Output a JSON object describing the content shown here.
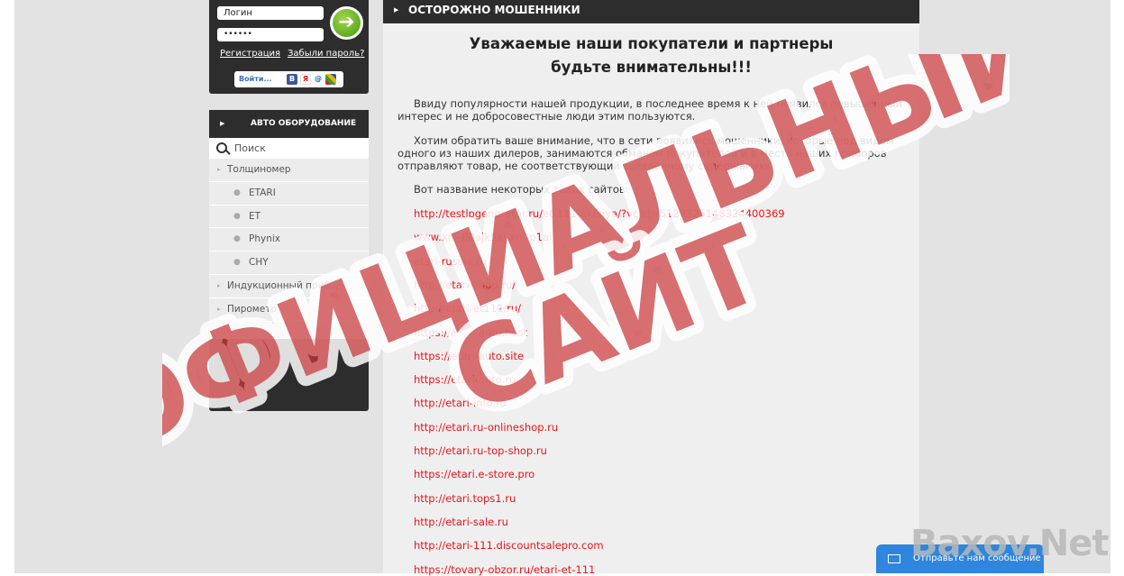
{
  "login": {
    "login_value": "Логин",
    "password_value": "••••••",
    "register_label": "Регистрация",
    "forgot_label": "Забыли пароль?",
    "social_enter_label": "Войти..."
  },
  "catalog": {
    "title": "АВТО ОБОРУДОВАНИЕ",
    "search_placeholder": "Поиск",
    "items": [
      {
        "label": "Толщиномер",
        "level": 0
      },
      {
        "label": "ETARI",
        "level": 1
      },
      {
        "label": "ET",
        "level": 1
      },
      {
        "label": "Phynix",
        "level": 1
      },
      {
        "label": "CHY",
        "level": 1
      },
      {
        "label": "Индукционный прибор",
        "level": 0
      },
      {
        "label": "Пирометр",
        "level": 0
      }
    ]
  },
  "content": {
    "section_title": "ОСТОРОЖНО МОШЕННИКИ",
    "headline_line1": "Уважаемые наши покупатели и партнеры",
    "headline_line2": "будьте внимательны!!!",
    "para1_line1": "Ввиду популярности нашей продукции, в последнее время к ней появился повышенный",
    "para1_line2": "интерес и не добросовестные люди этим пользуются.",
    "para2_line1": "Хотим обратить ваше внимание, что в сети появились мошенники, которые под видом",
    "para2_line2": "одного из наших дилеров, занимаются обманом покупателей и в место наших приборов",
    "para2_line3": "отправляют товар, не соответствующий заявленному содержанию.",
    "sites_intro": "Вот название некоторых таких сайтов:",
    "links": [
      "http://testlpgenerator.ru/et-111-aktsiya/?yclid=5128325148324400369",
      "www.xn--80ajk5ai.xn--p1ai",
      "etari-russia.ru",
      "http://etari-shop.ru/",
      "http://etari-et111.ru/",
      "https://etari-auto.host",
      "https://etari-auto.site",
      "https://etari-auto.ru",
      "http://etari-info.ru",
      "http://etari.ru-onlineshop.ru",
      "http://etari.ru-top-shop.ru",
      "https://etari.e-store.pro",
      "http://etari.tops1.ru",
      "http://etari-sale.ru",
      "http://etari-111.discountsalepro.com",
      "https://tovary-obzor.ru/etari-et-111"
    ]
  },
  "watermark": {
    "line1": "ОФИЦИАЛЬНЫЙ",
    "line2": "САЙТ",
    "color": "#c9383a"
  },
  "chat": {
    "label": "Отправьте нам сообщение"
  },
  "brand": {
    "text": "Baxov.Net"
  }
}
